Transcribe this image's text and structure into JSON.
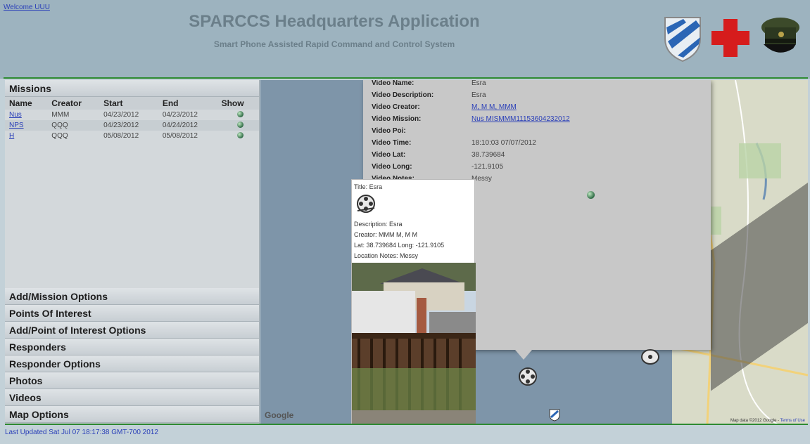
{
  "header": {
    "welcome": "Welcome UUU",
    "title": "SPARCCS Headquarters Application",
    "subtitle": "Smart Phone Assisted Rapid Command and Control System"
  },
  "missions": {
    "title": "Missions",
    "columns": [
      "Name",
      "Creator",
      "Start",
      "End",
      "Show"
    ],
    "rows": [
      {
        "name": "Nus",
        "creator": "MMM",
        "start": "04/23/2012",
        "end": "04/23/2012"
      },
      {
        "name": "NPS",
        "creator": "QQQ",
        "start": "04/23/2012",
        "end": "04/24/2012"
      },
      {
        "name": "H",
        "creator": "QQQ",
        "start": "05/08/2012",
        "end": "05/08/2012"
      }
    ]
  },
  "sections": [
    "Add/Mission Options",
    "Points Of Interest",
    "Add/Point of Interest Options",
    "Responders",
    "Responder Options",
    "Photos",
    "Videos",
    "Map Options"
  ],
  "info_window": {
    "rows": [
      {
        "label": "Video Name:",
        "value": "Esra"
      },
      {
        "label": "Video Description:",
        "value": "Esra"
      },
      {
        "label": "Video Creator:",
        "value": "M, M M, MMM"
      },
      {
        "label": "Video Mission:",
        "value": "Nus MISMMM11153604232012"
      },
      {
        "label": "Video Poi:",
        "value": ""
      },
      {
        "label": "Video Time:",
        "value": "18:10:03 07/07/2012"
      },
      {
        "label": "Video Lat:",
        "value": "38.739684"
      },
      {
        "label": "Video Long:",
        "value": "-121.9105"
      },
      {
        "label": "Video Notes:",
        "value": "Messy"
      }
    ]
  },
  "popup": {
    "title": "Title: Esra",
    "description": "Description: Esra",
    "creator": "Creator: MMM M, M M",
    "latlong": "Lat: 38.739684 Long: -121.9105",
    "notes": "Location Notes: Messy"
  },
  "map": {
    "google": "Google",
    "attribution": "Map data ©2012 Google - ",
    "terms": "Terms of Use"
  },
  "footer": {
    "status": "Last Updated Sat Jul 07 18:17:38 GMT-700 2012"
  },
  "colors": {
    "header_bg": "#9db3bf",
    "accent_green": "#2e8a32",
    "link": "#2a3fb8"
  }
}
